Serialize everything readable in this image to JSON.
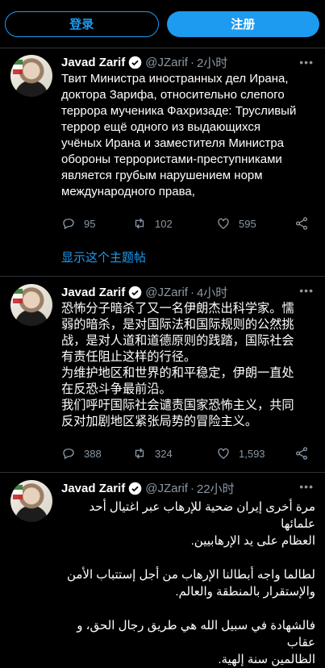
{
  "topbar": {
    "login_label": "登录",
    "signup_label": "注册"
  },
  "tweets": [
    {
      "name": "Javad Zarif",
      "handle": "@JZarif",
      "separator": "·",
      "time": "2小时",
      "more": "•••",
      "text": "Твит Министра иностранных дел Ирана,\nдоктора Зарифа, относительно слепого\nтеррора мученика Фахризаде: Трусливый\nтеррор ещё одного из выдающихся\nучёных Ирана и заместителя Министра\nобороны террористами-преступниками\nявляется грубым нарушением норм\nмеждународного права,",
      "replies": "95",
      "retweets": "102",
      "likes": "595",
      "thread_link": "显示这个主题帖"
    },
    {
      "name": "Javad Zarif",
      "handle": "@JZarif",
      "separator": "·",
      "time": "4小时",
      "more": "•••",
      "text": "恐怖分子暗杀了又一名伊朗杰出科学家。懦\n弱的暗杀，是对国际法和国际规则的公然挑\n战，是对人道和道德原则的践踏，国际社会\n有责任阻止这样的行径。\n为维护地区和世界的和平稳定，伊朗一直处\n在反恐斗争最前沿。\n我们呼吁国际社会谴责国家恐怖主义，共同\n反对加剧地区紧张局势的冒险主义。",
      "replies": "388",
      "retweets": "324",
      "likes": "1,593"
    },
    {
      "name": "Javad Zarif",
      "handle": "@JZarif",
      "separator": "·",
      "time": "22小时",
      "more": "•••",
      "text": "مرة أخرى إيران ضحية للإرهاب عبر اغتيال أحد علمائها\nالعظام على يد الإرهابيين.\n\nلطالما واجه أبطالنا الإرهاب من أجل إستتباب الأمن\nوالإستقرار بالمنطقة والعالم.\n\nفالشهادة في سبيل الله هي طريق رجال الحق، و عقاب\nالظالمين سنة إلهية."
    }
  ],
  "colors": {
    "accent": "#1d9bf0",
    "muted": "#8b98a5",
    "background": "#000000"
  }
}
